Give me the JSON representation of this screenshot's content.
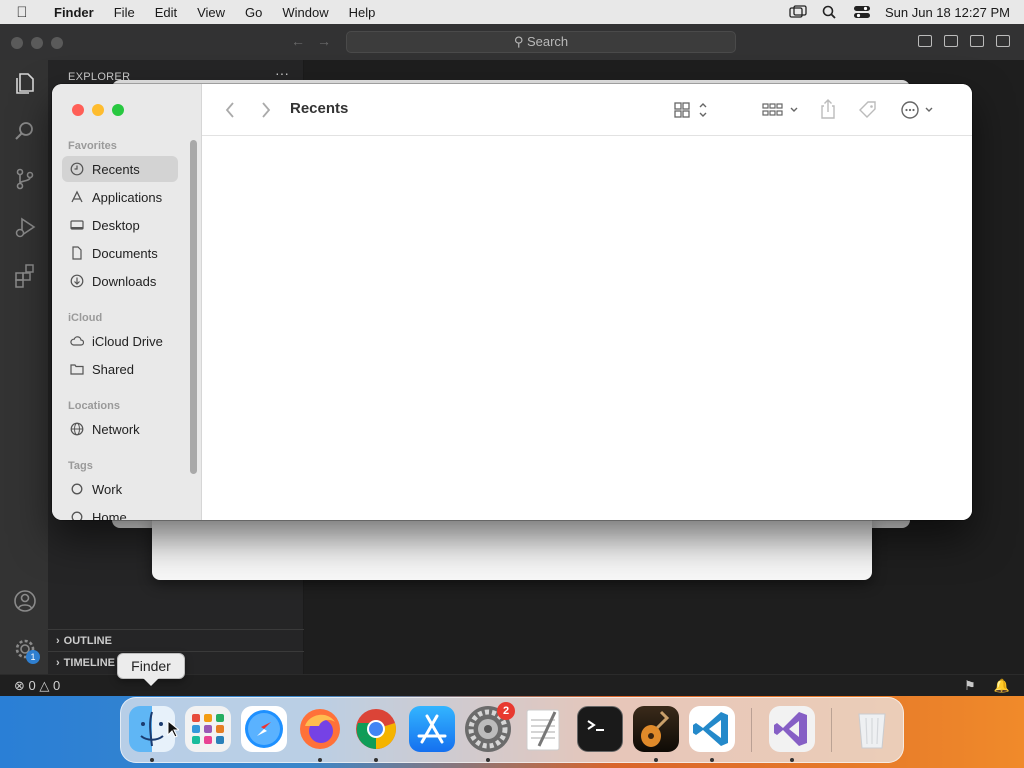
{
  "menubar": {
    "app_name": "Finder",
    "items": [
      "File",
      "Edit",
      "View",
      "Go",
      "Window",
      "Help"
    ],
    "datetime": "Sun Jun 18  12:27 PM"
  },
  "vscode": {
    "search_placeholder": "Search",
    "explorer_label": "EXPLORER",
    "explorer_more": "···",
    "sections": [
      "OUTLINE",
      "TIMELINE"
    ],
    "status_errors": "0",
    "status_warnings": "0",
    "settings_badge": "1"
  },
  "finder": {
    "title": "Recents",
    "groups": {
      "favorites": "Favorites",
      "icloud": "iCloud",
      "locations": "Locations",
      "tags": "Tags"
    },
    "favorites": [
      {
        "label": "Recents",
        "icon": "clock-icon",
        "selected": true
      },
      {
        "label": "Applications",
        "icon": "applications-icon"
      },
      {
        "label": "Desktop",
        "icon": "desktop-icon"
      },
      {
        "label": "Documents",
        "icon": "document-icon"
      },
      {
        "label": "Downloads",
        "icon": "download-icon"
      }
    ],
    "icloud": [
      {
        "label": "iCloud Drive",
        "icon": "cloud-icon"
      },
      {
        "label": "Shared",
        "icon": "shared-folder-icon"
      }
    ],
    "locations": [
      {
        "label": "Network",
        "icon": "globe-icon"
      }
    ],
    "tags": [
      {
        "label": "Work",
        "icon": "tag-circle-icon"
      },
      {
        "label": "Home",
        "icon": "tag-circle-icon"
      }
    ]
  },
  "tooltip": "Finder",
  "dock": {
    "apps": [
      "Finder",
      "Launchpad",
      "Safari",
      "Firefox",
      "Chrome",
      "App Store",
      "System Settings",
      "TextEdit",
      "Terminal",
      "GarageBand",
      "Visual Studio Code",
      "Visual Studio",
      "Trash"
    ],
    "settings_badge": "2"
  },
  "colors": {
    "finder_close": "#ff5f57",
    "finder_minimize": "#febc2e",
    "finder_zoom": "#28c840",
    "vscode_bg": "#1e1e1e"
  }
}
